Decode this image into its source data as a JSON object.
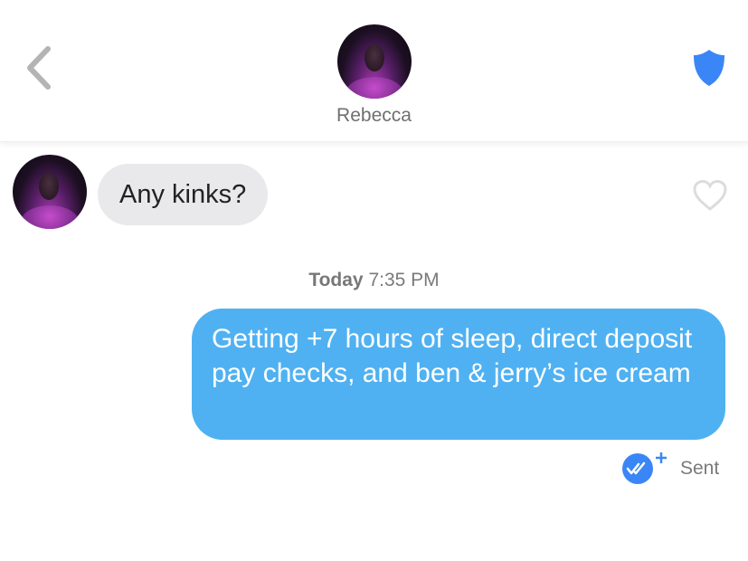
{
  "header": {
    "profile_name": "Rebecca",
    "back_icon": "chevron-left-icon",
    "safety_icon": "shield-icon"
  },
  "messages": {
    "incoming": {
      "text": "Any kinks?"
    },
    "timestamp": {
      "day": "Today",
      "time": "7:35 PM"
    },
    "outgoing": {
      "text": "Getting +7 hours of sleep, direct deposit pay checks, and ben & jerry’s ice cream",
      "status": "Sent"
    }
  },
  "icons": {
    "like": "heart-outline-icon",
    "read_receipt": "read-receipt-plus-icon"
  },
  "colors": {
    "outgoing_bubble": "#4fb1f2",
    "incoming_bubble": "#e9e9eb",
    "shield": "#3b86f6",
    "read_receipt": "#3b86f6"
  }
}
